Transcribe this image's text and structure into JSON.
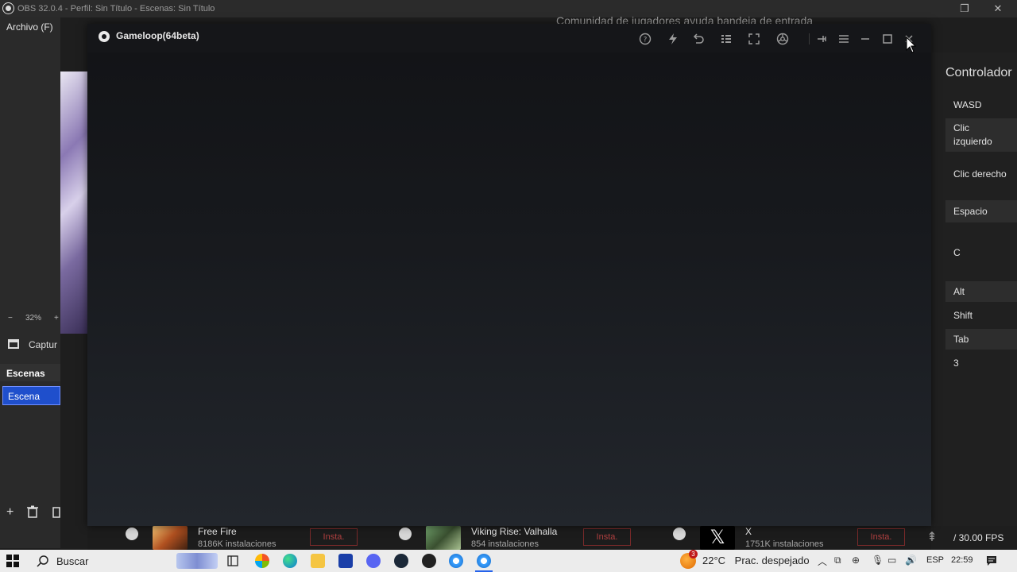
{
  "obs": {
    "title": "OBS 32.0.4 - Perfil: Sin Título - Escenas: Sin Título",
    "menu_file": "Archivo (F)",
    "zoom": "32%",
    "zoom_minus": "−",
    "zoom_plus": "+",
    "source_label": "Captur",
    "scenes_header": "Escenas",
    "scene_item": "Escena",
    "fps": "/ 30.00 FPS",
    "right_links": "Comunidad de jugadores   ayuda   bandeja de entrada"
  },
  "controls": {
    "title": "Controlador",
    "items": [
      "WASD",
      "Clic izquierdo",
      "Clic derecho",
      "Espacio",
      "C",
      "Alt",
      "Shift",
      "Tab",
      "3"
    ]
  },
  "gameloop": {
    "title": "Gameloop(64beta)",
    "buttons": [
      "help",
      "boost",
      "undo",
      "grid",
      "fullscreen",
      "controller",
      "pin",
      "menu",
      "minimize",
      "maximize",
      "close"
    ]
  },
  "games": [
    {
      "name": "Free Fire",
      "installs": "8186K instalaciones",
      "action": "Insta."
    },
    {
      "name": "Viking Rise: Valhalla",
      "installs": "854 instalaciones",
      "action": "Insta."
    },
    {
      "name": "X",
      "installs": "1751K instalaciones",
      "action": "Insta."
    }
  ],
  "taskbar": {
    "search_placeholder": "Buscar",
    "weather_temp": "22°C",
    "weather_desc": "Prac. despejado",
    "weather_badge": "3",
    "language": "ESP",
    "time": "22:59"
  },
  "colors": {
    "accent": "#1f4fcc",
    "install_red": "#b04040",
    "taskbar_bg": "#ececec"
  }
}
